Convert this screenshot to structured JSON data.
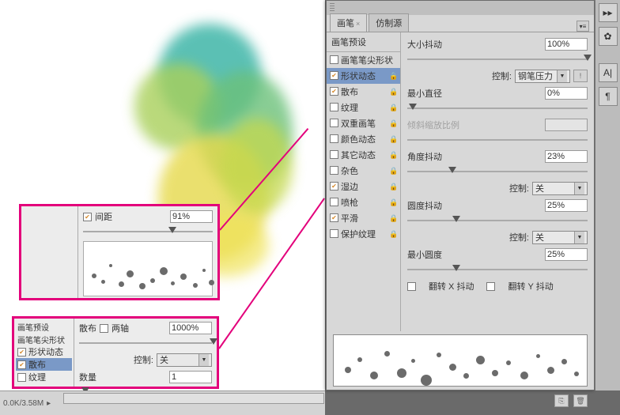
{
  "statusbar": {
    "text": "0.0K/3.58M"
  },
  "panel": {
    "tabs": {
      "brush": "画笔",
      "clone": "仿制源"
    },
    "preset_header": "画笔预设",
    "items": [
      {
        "label": "画笔笔尖形状",
        "chk": false,
        "lock": false
      },
      {
        "label": "形状动态",
        "chk": true,
        "lock": true,
        "sel": true
      },
      {
        "label": "散布",
        "chk": true,
        "lock": true
      },
      {
        "label": "纹理",
        "chk": false,
        "lock": true
      },
      {
        "label": "双重画笔",
        "chk": false,
        "lock": true
      },
      {
        "label": "颜色动态",
        "chk": false,
        "lock": true
      },
      {
        "label": "其它动态",
        "chk": false,
        "lock": true
      },
      {
        "label": "杂色",
        "chk": false,
        "lock": true
      },
      {
        "label": "湿边",
        "chk": true,
        "lock": true
      },
      {
        "label": "喷枪",
        "chk": false,
        "lock": true
      },
      {
        "label": "平滑",
        "chk": true,
        "lock": true
      },
      {
        "label": "保护纹理",
        "chk": false,
        "lock": true
      }
    ],
    "settings": {
      "size_jitter_label": "大小抖动",
      "size_jitter": "100%",
      "control_label": "控制:",
      "control1": "钢笔压力",
      "min_diameter_label": "最小直径",
      "min_diameter": "0%",
      "tilt_scale_label": "倾斜缩放比例",
      "angle_jitter_label": "角度抖动",
      "angle_jitter": "23%",
      "control2": "关",
      "round_jitter_label": "圆度抖动",
      "round_jitter": "25%",
      "control3": "关",
      "min_round_label": "最小圆度",
      "min_round": "25%",
      "flipx": "翻转 X 抖动",
      "flipy": "翻转 Y 抖动"
    }
  },
  "callout1": {
    "spacing_label": "间距",
    "spacing": "91%"
  },
  "callout2": {
    "preset_header": "画笔预设",
    "items": [
      "画笔笔尖形状",
      "形状动态",
      "散布",
      "纹理"
    ],
    "scatter_label": "散布",
    "both_axes": "两轴",
    "scatter_val": "1000%",
    "control_label": "控制:",
    "control_val": "关",
    "count_label": "数量",
    "count_val": "1"
  },
  "icons": {
    "x_badge": "×"
  }
}
